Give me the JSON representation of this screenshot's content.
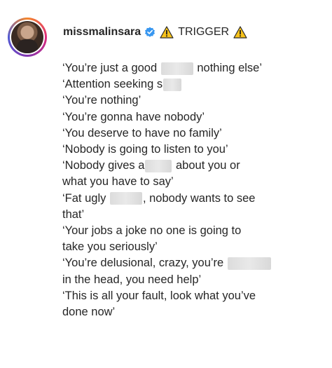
{
  "header": {
    "username": "missmalinsara",
    "verified_icon": "verified-badge-icon",
    "warning_icon": "warning-triangle-icon",
    "trigger_label": "TRIGGER",
    "accent_color": "#3897f0"
  },
  "caption": {
    "lines": [
      {
        "before": "‘You’re just a good",
        "redacted": true,
        "after": "nothing else’"
      },
      {
        "before": "‘Attention seeking s",
        "redacted": true,
        "after": ""
      },
      {
        "before": "‘You’re nothing’",
        "redacted": false,
        "after": ""
      },
      {
        "before": "‘You’re gonna have nobody’",
        "redacted": false,
        "after": ""
      },
      {
        "before": "‘You deserve to have no family’",
        "redacted": false,
        "after": ""
      },
      {
        "before": "‘Nobody is going to listen to you’",
        "redacted": false,
        "after": ""
      },
      {
        "before": "‘Nobody gives a",
        "redacted": true,
        "after": "about you or"
      },
      {
        "before": "what you have to say’",
        "redacted": false,
        "after": ""
      },
      {
        "before": "‘Fat ugly",
        "redacted": true,
        "after": ", nobody wants to see"
      },
      {
        "before": "that’",
        "redacted": false,
        "after": ""
      },
      {
        "before": "‘Your jobs a joke no one is going to",
        "redacted": false,
        "after": ""
      },
      {
        "before": "take you seriously’",
        "redacted": false,
        "after": ""
      },
      {
        "before": "‘You’re delusional, crazy, you’re",
        "redacted": true,
        "after": ""
      },
      {
        "before": "in the head, you need help’",
        "redacted": false,
        "after": ""
      },
      {
        "before": "‘This is all your fault, look what you’ve",
        "redacted": false,
        "after": ""
      },
      {
        "before": "done now’",
        "redacted": false,
        "after": ""
      }
    ]
  }
}
